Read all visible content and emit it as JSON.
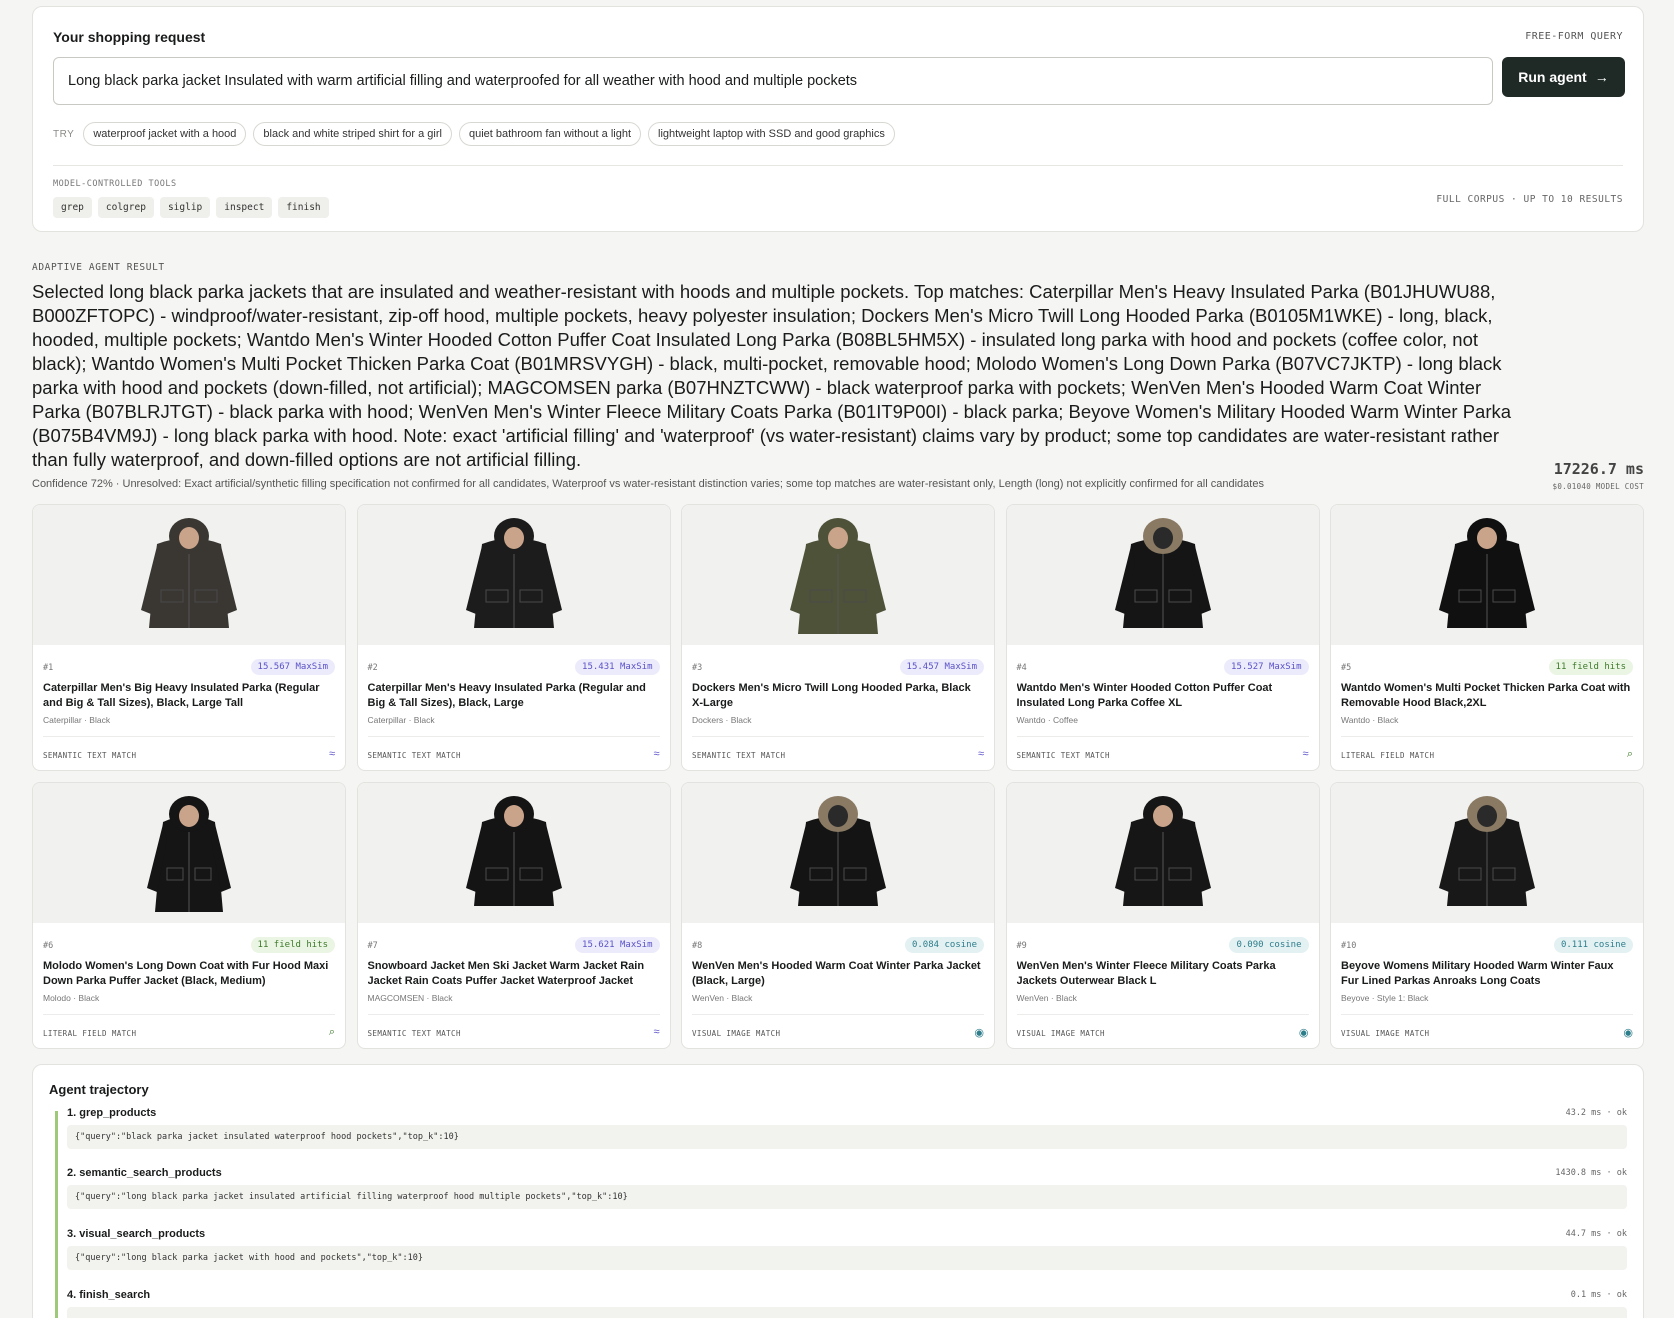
{
  "request": {
    "title": "Your shopping request",
    "mode_tag": "FREE-FORM QUERY",
    "query_value": "Long black parka jacket Insulated with warm artificial filling and waterproofed for all weather with hood and multiple pockets",
    "run_label": "Run agent",
    "try_label": "TRY",
    "suggestions": [
      "waterproof jacket with a hood",
      "black and white striped shirt for a girl",
      "quiet bathroom fan without a light",
      "lightweight laptop with SSD and good graphics"
    ],
    "tools_label": "MODEL-CONTROLLED TOOLS",
    "tools": [
      "grep",
      "colgrep",
      "siglip",
      "inspect",
      "finish"
    ],
    "corpus_note": "FULL CORPUS · UP TO 10 RESULTS"
  },
  "result": {
    "label": "ADAPTIVE AGENT RESULT",
    "summary": "Selected long black parka jackets that are insulated and weather-resistant with hoods and multiple pockets. Top matches: Caterpillar Men's Heavy Insulated Parka (B01JHUWU88, B000ZFTOPC) - windproof/water-resistant, zip-off hood, multiple pockets, heavy polyester insulation; Dockers Men's Micro Twill Long Hooded Parka (B0105M1WKE) - long, black, hooded, multiple pockets; Wantdo Men's Winter Hooded Cotton Puffer Coat Insulated Long Parka (B08BL5HM5X) - insulated long parka with hood and pockets (coffee color, not black); Wantdo Women's Multi Pocket Thicken Parka Coat (B01MRSVYGH) - black, multi-pocket, removable hood; Molodo Women's Long Down Parka (B07VC7JKTP) - long black parka with hood and pockets (down-filled, not artificial); MAGCOMSEN parka (B07HNZTCWW) - black waterproof parka with pockets; WenVen Men's Hooded Warm Coat Winter Parka (B07BLRJTGT) - black parka with hood; WenVen Men's Winter Fleece Military Coats Parka (B01IT9P00I) - black parka; Beyove Women's Military Hooded Warm Winter Parka (B075B4VM9J) - long black parka with hood. Note: exact 'artificial filling' and 'waterproof' (vs water-resistant) claims vary by product; some top candidates are water-resistant rather than fully waterproof, and down-filled options are not artificial filling.",
    "confidence": "Confidence 72% · Unresolved: Exact artificial/synthetic filling specification not confirmed for all candidates, Waterproof vs water-resistant distinction varies; some top matches are water-resistant only, Length (long) not explicitly confirmed for all candidates",
    "latency": "17226.7 ms",
    "cost": "$0.01040 MODEL COST"
  },
  "products": [
    {
      "rank": "#1",
      "score": "15.567 MaxSim",
      "kind": "semantic",
      "title": "Caterpillar Men's Big Heavy Insulated Parka (Regular and Big & Tall Sizes), Black, Large Tall",
      "meta": "Caterpillar · Black",
      "match": "SEMANTIC TEXT MATCH",
      "icon": "≈",
      "img_color": "#3a3733",
      "img_shape": "parka"
    },
    {
      "rank": "#2",
      "score": "15.431 MaxSim",
      "kind": "semantic",
      "title": "Caterpillar Men's Heavy Insulated Parka (Regular and Big & Tall Sizes), Black, Large",
      "meta": "Caterpillar · Black",
      "match": "SEMANTIC TEXT MATCH",
      "icon": "≈",
      "img_color": "#1c1c1c",
      "img_shape": "parka"
    },
    {
      "rank": "#3",
      "score": "15.457 MaxSim",
      "kind": "semantic",
      "title": "Dockers Men's Micro Twill Long Hooded Parka, Black X-Large",
      "meta": "Dockers · Black",
      "match": "SEMANTIC TEXT MATCH",
      "icon": "≈",
      "img_color": "#4d5239",
      "img_shape": "long"
    },
    {
      "rank": "#4",
      "score": "15.527 MaxSim",
      "kind": "semantic",
      "title": "Wantdo Men's Winter Hooded Cotton Puffer Coat Insulated Long Parka Coffee XL",
      "meta": "Wantdo · Coffee",
      "match": "SEMANTIC TEXT MATCH",
      "icon": "≈",
      "img_color": "#151515",
      "img_shape": "fur"
    },
    {
      "rank": "#5",
      "score": "11 field hits",
      "kind": "literal",
      "title": "Wantdo Women's Multi Pocket Thicken Parka Coat with Removable Hood Black,2XL",
      "meta": "Wantdo · Black",
      "match": "LITERAL FIELD MATCH",
      "icon": "⌕",
      "img_color": "#101010",
      "img_shape": "hooded"
    },
    {
      "rank": "#6",
      "score": "11 field hits",
      "kind": "literal",
      "title": "Molodo Women's Long Down Coat with Fur Hood Maxi Down Parka Puffer Jacket (Black, Medium)",
      "meta": "Molodo · Black",
      "match": "LITERAL FIELD MATCH",
      "icon": "⌕",
      "img_color": "#151515",
      "img_shape": "maxi"
    },
    {
      "rank": "#7",
      "score": "15.621 MaxSim",
      "kind": "semantic",
      "title": "Snowboard Jacket Men Ski Jacket Warm Jacket Rain Jacket Rain Coats Puffer Jacket Waterproof Jacket Tactical Jacket",
      "meta": "MAGCOMSEN · Black",
      "match": "SEMANTIC TEXT MATCH",
      "icon": "≈",
      "img_color": "#141414",
      "img_shape": "parka"
    },
    {
      "rank": "#8",
      "score": "0.084 cosine",
      "kind": "visual",
      "title": "WenVen Men's Hooded Warm Coat Winter Parka Jacket (Black, Large)",
      "meta": "WenVen · Black",
      "match": "VISUAL IMAGE MATCH",
      "icon": "◉",
      "img_color": "#141414",
      "img_shape": "fur"
    },
    {
      "rank": "#9",
      "score": "0.090 cosine",
      "kind": "visual",
      "title": "WenVen Men's Winter Fleece Military Coats Parka Jackets Outerwear Black L",
      "meta": "WenVen · Black",
      "match": "VISUAL IMAGE MATCH",
      "icon": "◉",
      "img_color": "#161616",
      "img_shape": "hooded"
    },
    {
      "rank": "#10",
      "score": "0.111 cosine",
      "kind": "visual",
      "title": "Beyove Womens Military Hooded Warm Winter Faux Fur Lined Parkas Anroaks Long Coats",
      "meta": "Beyove · Style 1: Black",
      "match": "VISUAL IMAGE MATCH",
      "icon": "◉",
      "img_color": "#181818",
      "img_shape": "fur"
    }
  ],
  "trajectory": {
    "title": "Agent trajectory",
    "steps": [
      {
        "name": "1. grep_products",
        "stat": "43.2 ms · ok",
        "args": "{\"query\":\"black parka jacket insulated waterproof hood pockets\",\"top_k\":10}"
      },
      {
        "name": "2. semantic_search_products",
        "stat": "1430.8 ms · ok",
        "args": "{\"query\":\"long black parka jacket insulated artificial filling waterproof hood multiple pockets\",\"top_k\":10}"
      },
      {
        "name": "3. visual_search_products",
        "stat": "44.7 ms · ok",
        "args": "{\"query\":\"long black parka jacket with hood and pockets\",\"top_k\":10}"
      },
      {
        "name": "4. finish_search",
        "stat": "0.1 ms · ok",
        "args": ""
      }
    ]
  }
}
